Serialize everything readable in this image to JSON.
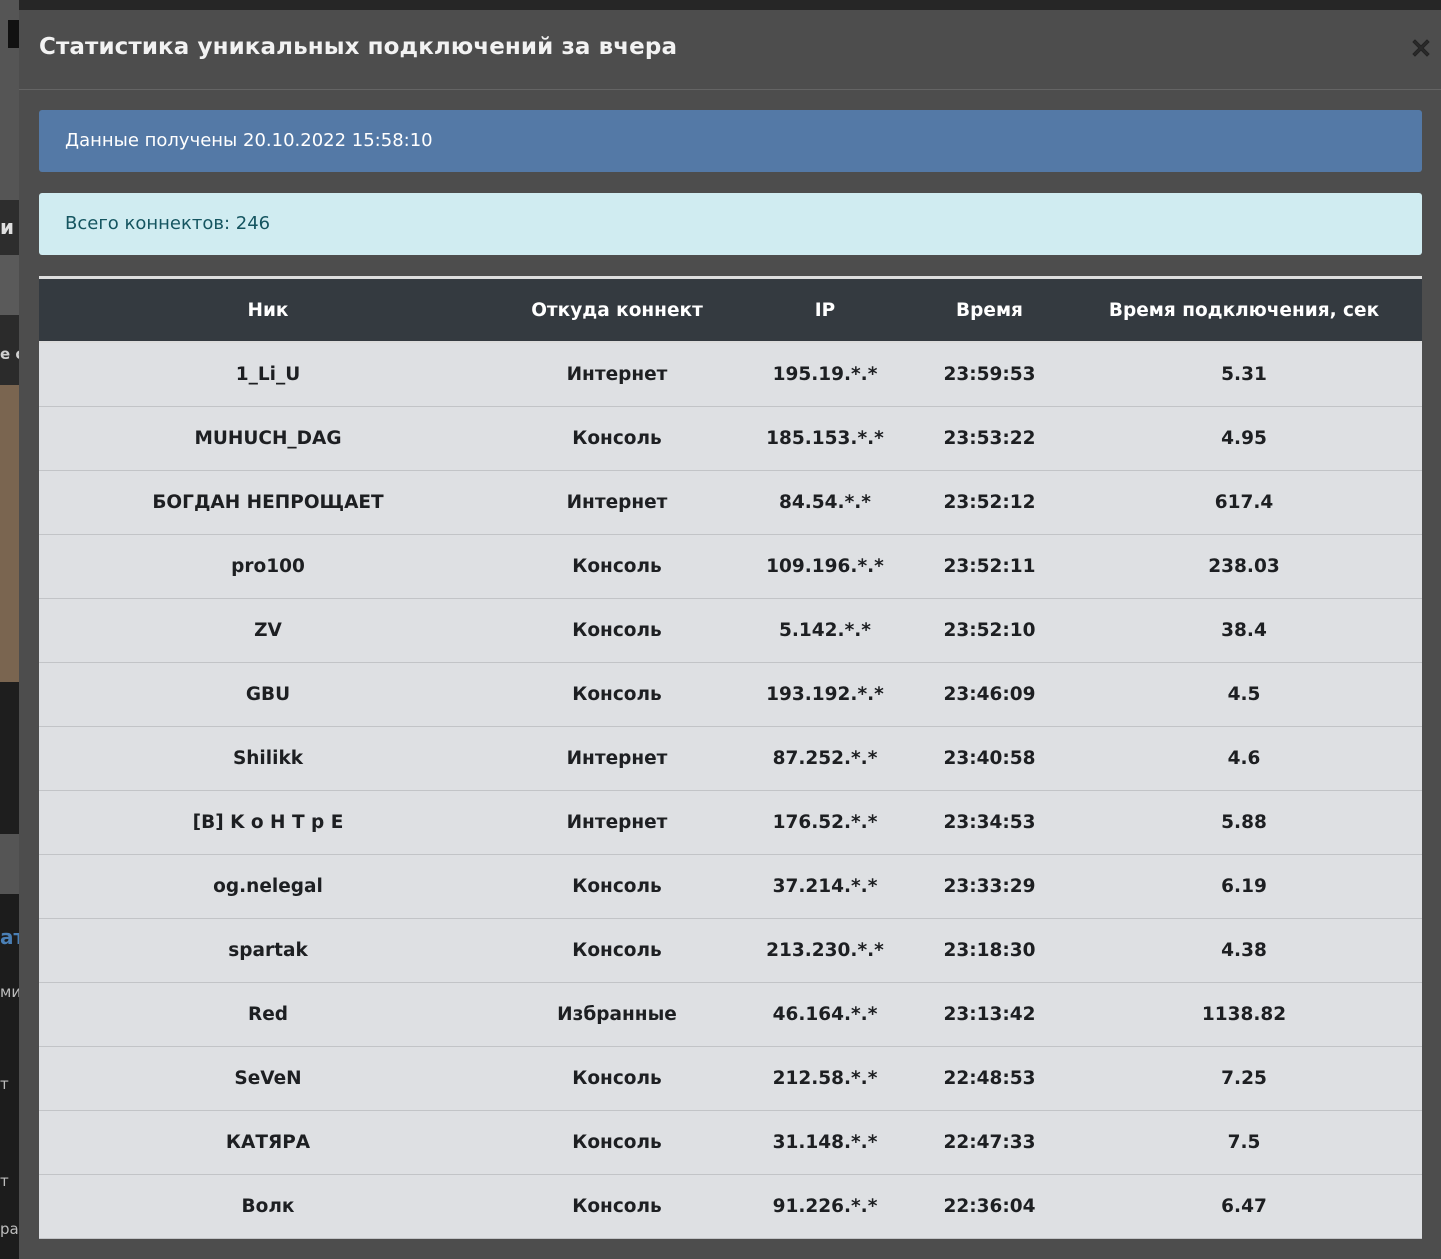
{
  "modal": {
    "title": "Статистика уникальных подключений за вчера",
    "received_label": "Данные получены 20.10.2022 15:58:10",
    "total_label": "Всего коннектов: 246"
  },
  "table": {
    "headers": [
      "Ник",
      "Откуда коннект",
      "IP",
      "Время",
      "Время подключения, сек"
    ],
    "rows": [
      [
        "1_Li_U",
        "Интернет",
        "195.19.*.*",
        "23:59:53",
        "5.31"
      ],
      [
        "MUHUCH_DAG",
        "Консоль",
        "185.153.*.*",
        "23:53:22",
        "4.95"
      ],
      [
        "БОГДАН НЕПРОЩАЕТ",
        "Интернет",
        "84.54.*.*",
        "23:52:12",
        "617.4"
      ],
      [
        "pro100",
        "Консоль",
        "109.196.*.*",
        "23:52:11",
        "238.03"
      ],
      [
        "ZV",
        "Консоль",
        "5.142.*.*",
        "23:52:10",
        "38.4"
      ],
      [
        "GBU",
        "Консоль",
        "193.192.*.*",
        "23:46:09",
        "4.5"
      ],
      [
        "Shilikk",
        "Интернет",
        "87.252.*.*",
        "23:40:58",
        "4.6"
      ],
      [
        "[B] K o H T p E",
        "Интернет",
        "176.52.*.*",
        "23:34:53",
        "5.88"
      ],
      [
        "og.nelegal",
        "Консоль",
        "37.214.*.*",
        "23:33:29",
        "6.19"
      ],
      [
        "spartak",
        "Консоль",
        "213.230.*.*",
        "23:18:30",
        "4.38"
      ],
      [
        "Red",
        "Избранные",
        "46.164.*.*",
        "23:13:42",
        "1138.82"
      ],
      [
        "SeVeN",
        "Консоль",
        "212.58.*.*",
        "22:48:53",
        "7.25"
      ],
      [
        "КАТЯРА",
        "Консоль",
        "31.148.*.*",
        "22:47:33",
        "7.5"
      ],
      [
        "Волк",
        "Консоль",
        "91.226.*.*",
        "22:36:04",
        "6.47"
      ]
    ]
  },
  "background": {
    "fragments": [
      "и",
      "е с",
      "ат",
      "ми",
      "т",
      "т",
      "ра"
    ]
  },
  "colors": {
    "modal_bg": "#4d4d4d",
    "primary_alert": "#5479a6",
    "info_alert": "#d0ecf1",
    "table_header": "#343a40",
    "row_bg": "#dee0e3"
  },
  "icons": {
    "close": "close-icon"
  }
}
